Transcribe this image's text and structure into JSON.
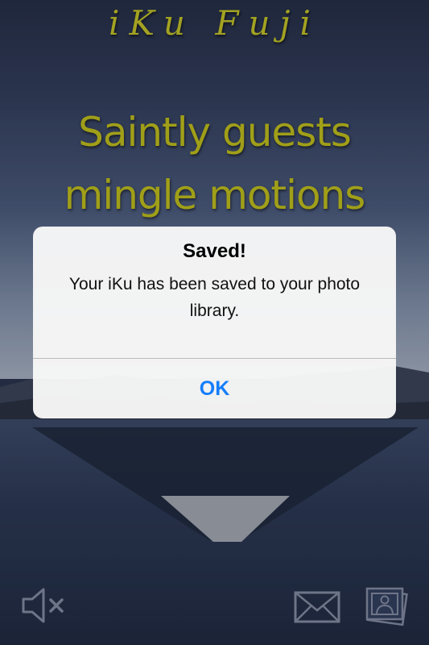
{
  "app": {
    "title": "iKu Fuji"
  },
  "poem": {
    "lines": [
      "Saintly guests",
      "mingle motions"
    ]
  },
  "alert": {
    "title": "Saved!",
    "message": "Your iKu has been saved to your photo library.",
    "ok_label": "OK"
  },
  "toolbar": {
    "mute_icon": "speaker-muted-icon",
    "mail_icon": "mail-envelope-icon",
    "photos_icon": "photo-library-icon"
  },
  "colors": {
    "poem_text": "#c4c21e",
    "alert_button": "#157efb",
    "alert_background": "#f7f7f7"
  }
}
